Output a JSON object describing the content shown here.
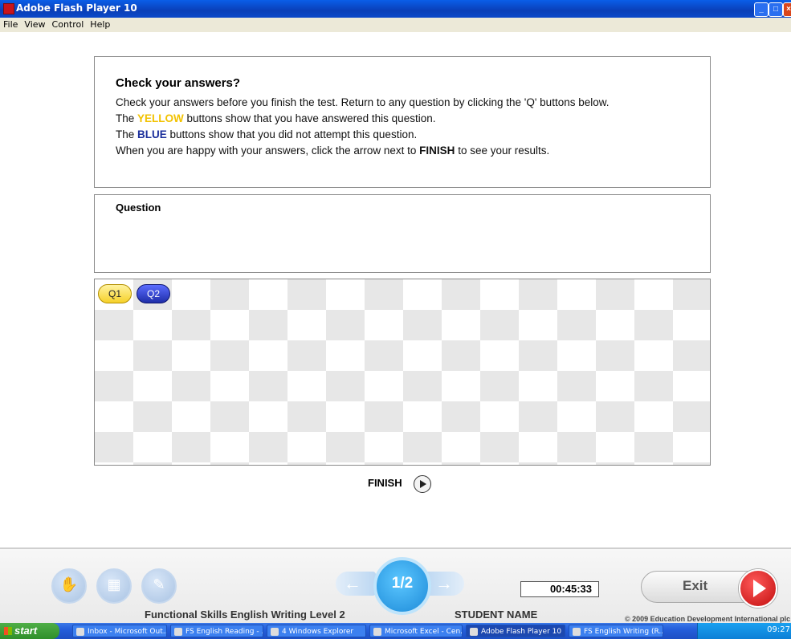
{
  "window": {
    "title": "Adobe Flash Player 10"
  },
  "menu": [
    "File",
    "View",
    "Control",
    "Help"
  ],
  "instructions": {
    "heading": "Check your answers?",
    "line1": "Check your answers before you finish the test. Return to any question by clicking the 'Q' buttons below.",
    "line2_pre": "The ",
    "line2_color": "YELLOW",
    "line2_post": " buttons show that you have answered this question.",
    "line3_pre": "The ",
    "line3_color": "BLUE",
    "line3_post": " buttons show that you did not attempt this question.",
    "line4_pre": "When you are happy with your answers, click the arrow next to ",
    "line4_bold": "FINISH",
    "line4_post": " to see your results."
  },
  "question_panel": {
    "label": "Question"
  },
  "question_buttons": [
    {
      "label": "Q1",
      "state": "answered",
      "color": "#f6d12a"
    },
    {
      "label": "Q2",
      "state": "not-attempted",
      "color": "#1f2ea8"
    }
  ],
  "finish": {
    "label": "FINISH"
  },
  "footer": {
    "course_title": "Functional Skills English Writing Level 2",
    "page_indicator": "1/2",
    "timer": "00:45:33",
    "student_label": "STUDENT NAME",
    "exit_label": "Exit",
    "copyright": "© 2009 Education Development International plc"
  },
  "taskbar": {
    "start_label": "start",
    "tasks": [
      {
        "label": "Inbox - Microsoft Out...",
        "active": false
      },
      {
        "label": "FS English Reading - ...",
        "active": false
      },
      {
        "label": "4 Windows Explorer",
        "active": false
      },
      {
        "label": "Microsoft Excel - Cen...",
        "active": false
      },
      {
        "label": "Adobe Flash Player 10",
        "active": true
      },
      {
        "label": "FS English Writing (R...",
        "active": false
      }
    ],
    "clock": "09:27"
  }
}
